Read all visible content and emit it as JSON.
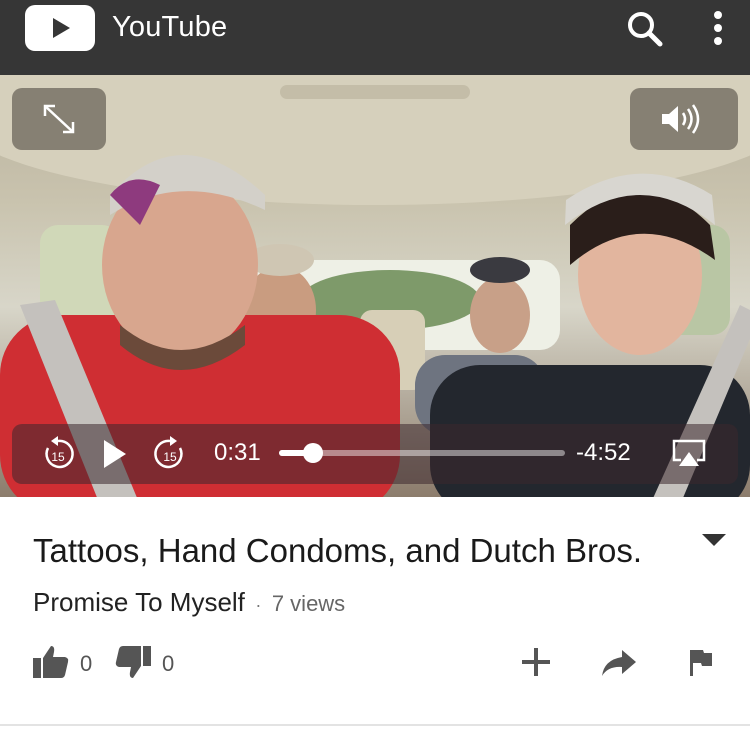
{
  "appbar": {
    "title": "YouTube",
    "icons": [
      "youtube-logo-icon",
      "search-icon",
      "more-vert-icon"
    ]
  },
  "player": {
    "current_time": "0:31",
    "remaining_time": "-4:52",
    "progress": 0.12,
    "skip_back_label": "15",
    "skip_forward_label": "15",
    "icons": [
      "fullscreen-icon",
      "volume-icon",
      "rewind-15-icon",
      "play-icon",
      "forward-15-icon",
      "airplay-icon"
    ]
  },
  "video": {
    "title": "Tattoos, Hand Condoms, and Dutch Bros.",
    "channel": "Promise To Myself",
    "separator": "·",
    "views": "7 views"
  },
  "actions": {
    "likes": "0",
    "dislikes": "0",
    "icons": [
      "thumbs-up-icon",
      "thumbs-down-icon",
      "add-to-playlist-icon",
      "share-icon",
      "flag-icon"
    ]
  },
  "colors": {
    "appbar_bg": "#363636",
    "accent_red": "#e62117"
  }
}
